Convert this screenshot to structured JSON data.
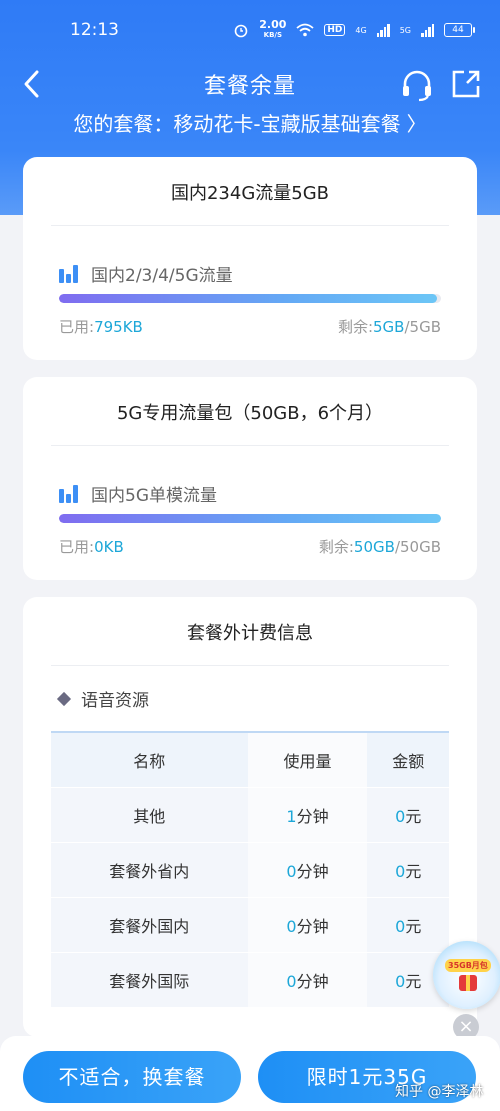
{
  "status_bar": {
    "time": "12:13",
    "speed_value": "2.00",
    "speed_unit": "KB/S",
    "hd": "HD",
    "net1": "4G",
    "net2": "5G",
    "battery": "44"
  },
  "header": {
    "title": "套餐余量",
    "plan_text": "您的套餐：移动花卡-宝藏版基础套餐",
    "plan_chevron": "〉"
  },
  "cards": [
    {
      "title": "国内234G流量5GB",
      "item_label": "国内2/3/4/5G流量",
      "used_label": "已用:",
      "used_value": "795KB",
      "remain_label": "剩余:",
      "remain_value": "5GB",
      "remain_total": "/5GB",
      "progress_fraction": 0.99
    },
    {
      "title": "5G专用流量包（50GB，6个月）",
      "item_label": "国内5G单模流量",
      "used_label": "已用:",
      "used_value": "0KB",
      "remain_label": "剩余:",
      "remain_value": "50GB",
      "remain_total": "/50GB",
      "progress_fraction": 1.0
    }
  ],
  "extra_fees": {
    "title": "套餐外计费信息",
    "section_label": "语音资源",
    "columns": [
      "名称",
      "使用量",
      "金额"
    ],
    "rows": [
      {
        "name": "其他",
        "usage_num": "1",
        "usage_unit": "分钟",
        "amount_num": "0",
        "amount_unit": "元"
      },
      {
        "name": "套餐外省内",
        "usage_num": "0",
        "usage_unit": "分钟",
        "amount_num": "0",
        "amount_unit": "元"
      },
      {
        "name": "套餐外国内",
        "usage_num": "0",
        "usage_unit": "分钟",
        "amount_num": "0",
        "amount_unit": "元"
      },
      {
        "name": "套餐外国际",
        "usage_num": "0",
        "usage_unit": "分钟",
        "amount_num": "0",
        "amount_unit": "元"
      }
    ]
  },
  "bottom_buttons": {
    "left": "不适合，换套餐",
    "right": "限时1元35G"
  },
  "floating_promo": {
    "tag": "35GB月包",
    "close": "×"
  },
  "watermark": "知乎 @李泽林",
  "colors": {
    "brand_blue": "#2f7bf6",
    "value_cyan": "#1da7d8",
    "button_blue": "#1e8ff5"
  },
  "icons": [
    "back-icon",
    "headset-icon",
    "share-icon",
    "chart-bars-icon",
    "diamond-icon",
    "close-icon",
    "gift-icon"
  ]
}
